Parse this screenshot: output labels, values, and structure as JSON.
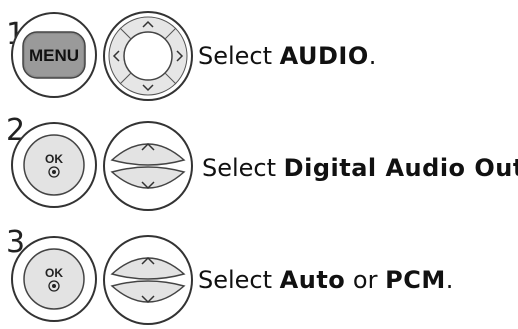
{
  "steps": [
    {
      "number": "1",
      "button_label": "MENU",
      "text_prefix": "Select ",
      "text_bold": "AUDIO",
      "text_suffix": "."
    },
    {
      "number": "2",
      "button_label": "OK",
      "text_prefix": "Select ",
      "text_bold": "Digital Audio Out",
      "text_suffix": "."
    },
    {
      "number": "3",
      "button_label": "OK",
      "text_prefix": "Select ",
      "text_bold": "Auto",
      "text_middle": " or ",
      "text_bold2": "PCM",
      "text_suffix": "."
    }
  ]
}
